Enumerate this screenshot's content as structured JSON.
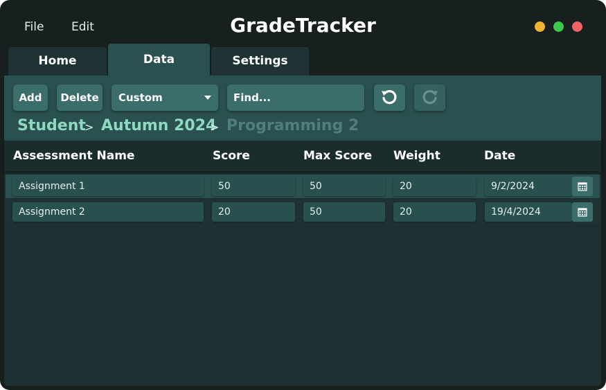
{
  "menu": {
    "file": "File",
    "edit": "Edit"
  },
  "app": {
    "title": "GradeTracker"
  },
  "window_controls": {
    "minimize_color": "#f2b234",
    "maximize_color": "#3cc84a",
    "close_color": "#f06363"
  },
  "tabs": [
    {
      "label": "Home",
      "active": false
    },
    {
      "label": "Data",
      "active": true
    },
    {
      "label": "Settings",
      "active": false
    }
  ],
  "toolbar": {
    "add_label": "Add",
    "delete_label": "Delete",
    "dropdown_value": "Custom",
    "search_placeholder": "Find...",
    "undo_icon": "undo-icon",
    "redo_icon": "redo-icon",
    "redo_enabled": false
  },
  "breadcrumb": {
    "items": [
      "Student",
      "Autumn 2024",
      "Programming 2"
    ],
    "separator": ">",
    "active_color": "#8fd8c2",
    "inactive_color": "#4f7f7b"
  },
  "table": {
    "columns": [
      "Assessment Name",
      "Score",
      "Max Score",
      "Weight",
      "Date"
    ],
    "rows": [
      {
        "name": "Assignment 1",
        "score": "50",
        "max_score": "50",
        "weight": "20",
        "date": "9/2/2024"
      },
      {
        "name": "Assignment 2",
        "score": "20",
        "max_score": "50",
        "weight": "20",
        "date": "19/4/2024"
      }
    ]
  },
  "colors": {
    "accent": "#3b6e6b",
    "panel": "#1e3132",
    "toolbar": "#2a5150",
    "window": "#171f1f"
  }
}
